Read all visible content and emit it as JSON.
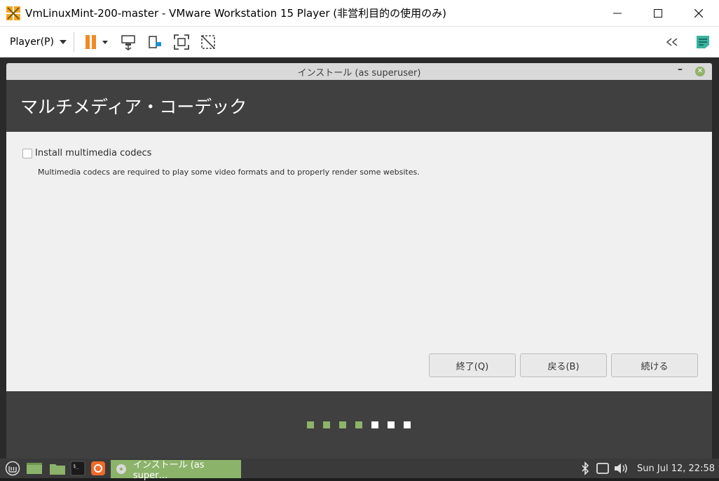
{
  "host": {
    "title": "VmLinuxMint-200-master - VMware Workstation 15 Player (非営利目的の使用のみ)",
    "player_menu_label": "Player(P)"
  },
  "dialog": {
    "title": "インストール (as superuser)",
    "heading": "マルチメディア・コーデック",
    "checkbox_label": "Install multimedia codecs",
    "checkbox_checked": false,
    "description": "Multimedia codecs are required to play some video formats and to properly render some websites.",
    "buttons": {
      "quit": "終了(Q)",
      "back": "戻る(B)",
      "continue": "続ける"
    },
    "progress": {
      "total_steps": 7,
      "completed_steps": 4,
      "completed_color": "#8fb36a",
      "pending_color": "#ffffff"
    }
  },
  "taskbar": {
    "task_label": "インストール (as super…",
    "clock": "Sun Jul 12, 22:58"
  },
  "colors": {
    "mint_green": "#8cb36a",
    "header_dark": "#404040",
    "vmware_orange": "#f08a24",
    "teal_accent": "#3bb3a0"
  }
}
